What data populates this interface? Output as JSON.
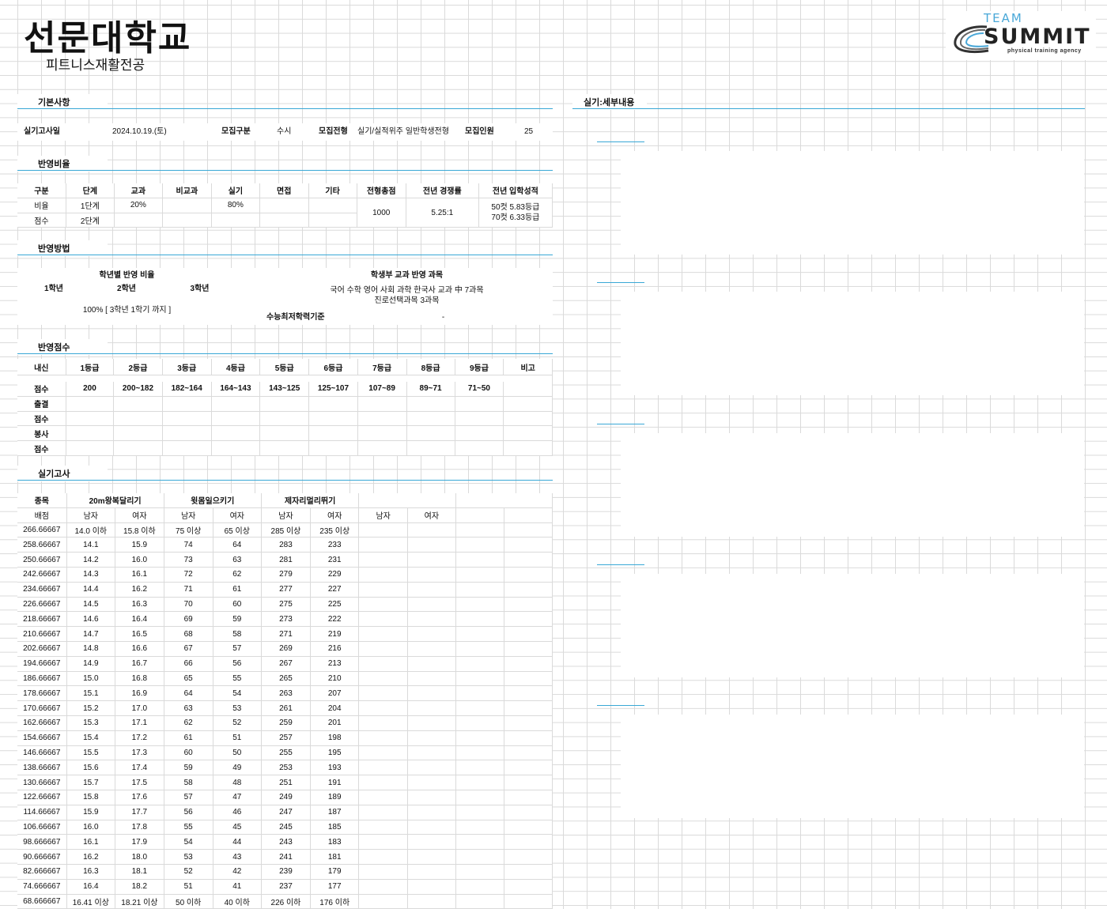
{
  "header": {
    "title": "선문대학교",
    "subtitle": "피트니스재활전공",
    "logo": {
      "team": "TEAM",
      "summit": "SUMMIT",
      "agency": "physical training agency"
    }
  },
  "sections": {
    "basic": "기본사항",
    "ratio": "반영비율",
    "method": "반영방법",
    "score": "반영점수",
    "practical": "실기고사",
    "detail": "실기:세부내용"
  },
  "basic": {
    "date_label": "실기고사일",
    "date_value": "2024.10.19.(토)",
    "category_label": "모집구분",
    "category_value": "수시",
    "type_label": "모집전형",
    "type_value": "실기/실적위주 일반학생전형",
    "quota_label": "모집인원",
    "quota_value": "25"
  },
  "ratio": {
    "headers": [
      "구분",
      "단계",
      "교과",
      "비교과",
      "실기",
      "면접",
      "기타",
      "전형총점",
      "전년 경쟁률",
      "전년 입학성적"
    ],
    "row1": [
      "비율",
      "1단계",
      "20%",
      "",
      "80%",
      "",
      ""
    ],
    "row2": [
      "점수",
      "2단계",
      "",
      "",
      "",
      "",
      ""
    ],
    "total": "1000",
    "competition": "5.25:1",
    "admission_1": "50컷 5.83등급",
    "admission_2": "70컷 6.33등급"
  },
  "method": {
    "grade_ratio_title": "학년별 반영 비율",
    "years": [
      "1학년",
      "2학년",
      "3학년"
    ],
    "ratio_text": "100% [ 3학년 1학기 까지 ]",
    "subjects_title": "학생부 교과 반영 과목",
    "subjects_line1": "국어 수학 영어 사회 과학 한국사 교과 中 7과목",
    "subjects_line2": "진로선택과목 3과목",
    "csat_label": "수능최저학력기준",
    "csat_value": "-"
  },
  "score": {
    "headers": [
      "내신",
      "1등급",
      "2등급",
      "3등급",
      "4등급",
      "5등급",
      "6등급",
      "7등급",
      "8등급",
      "9등급",
      "비고"
    ],
    "score_row": [
      "점수",
      "200",
      "200~182",
      "182~164",
      "164~143",
      "143~125",
      "125~107",
      "107~89",
      "89~71",
      "71~50",
      ""
    ],
    "extra_labels": [
      "출결",
      "점수",
      "봉사",
      "점수"
    ]
  },
  "practical": {
    "event_label": "종목",
    "events": [
      "20m왕복달리기",
      "윗몸일으키기",
      "제자리멀리뛰기"
    ],
    "score_label": "배점",
    "gender": [
      "남자",
      "여자",
      "남자",
      "여자",
      "남자",
      "여자",
      "남자",
      "여자"
    ],
    "rows": [
      [
        "266.66667",
        "14.0 이하",
        "15.8 이하",
        "75 이상",
        "65 이상",
        "285 이상",
        "235 이상"
      ],
      [
        "258.66667",
        "14.1",
        "15.9",
        "74",
        "64",
        "283",
        "233"
      ],
      [
        "250.66667",
        "14.2",
        "16.0",
        "73",
        "63",
        "281",
        "231"
      ],
      [
        "242.66667",
        "14.3",
        "16.1",
        "72",
        "62",
        "279",
        "229"
      ],
      [
        "234.66667",
        "14.4",
        "16.2",
        "71",
        "61",
        "277",
        "227"
      ],
      [
        "226.66667",
        "14.5",
        "16.3",
        "70",
        "60",
        "275",
        "225"
      ],
      [
        "218.66667",
        "14.6",
        "16.4",
        "69",
        "59",
        "273",
        "222"
      ],
      [
        "210.66667",
        "14.7",
        "16.5",
        "68",
        "58",
        "271",
        "219"
      ],
      [
        "202.66667",
        "14.8",
        "16.6",
        "67",
        "57",
        "269",
        "216"
      ],
      [
        "194.66667",
        "14.9",
        "16.7",
        "66",
        "56",
        "267",
        "213"
      ],
      [
        "186.66667",
        "15.0",
        "16.8",
        "65",
        "55",
        "265",
        "210"
      ],
      [
        "178.66667",
        "15.1",
        "16.9",
        "64",
        "54",
        "263",
        "207"
      ],
      [
        "170.66667",
        "15.2",
        "17.0",
        "63",
        "53",
        "261",
        "204"
      ],
      [
        "162.66667",
        "15.3",
        "17.1",
        "62",
        "52",
        "259",
        "201"
      ],
      [
        "154.66667",
        "15.4",
        "17.2",
        "61",
        "51",
        "257",
        "198"
      ],
      [
        "146.66667",
        "15.5",
        "17.3",
        "60",
        "50",
        "255",
        "195"
      ],
      [
        "138.66667",
        "15.6",
        "17.4",
        "59",
        "49",
        "253",
        "193"
      ],
      [
        "130.66667",
        "15.7",
        "17.5",
        "58",
        "48",
        "251",
        "191"
      ],
      [
        "122.66667",
        "15.8",
        "17.6",
        "57",
        "47",
        "249",
        "189"
      ],
      [
        "114.66667",
        "15.9",
        "17.7",
        "56",
        "46",
        "247",
        "187"
      ],
      [
        "106.66667",
        "16.0",
        "17.8",
        "55",
        "45",
        "245",
        "185"
      ],
      [
        "98.666667",
        "16.1",
        "17.9",
        "54",
        "44",
        "243",
        "183"
      ],
      [
        "90.666667",
        "16.2",
        "18.0",
        "53",
        "43",
        "241",
        "181"
      ],
      [
        "82.666667",
        "16.3",
        "18.1",
        "52",
        "42",
        "239",
        "179"
      ],
      [
        "74.666667",
        "16.4",
        "18.2",
        "51",
        "41",
        "237",
        "177"
      ],
      [
        "68.666667",
        "16.41 이상",
        "18.21 이상",
        "50 이하",
        "40 이하",
        "226 이하",
        "176 이하"
      ]
    ]
  },
  "colors": {
    "accent": "#39a8d6",
    "grid": "#dadada"
  }
}
